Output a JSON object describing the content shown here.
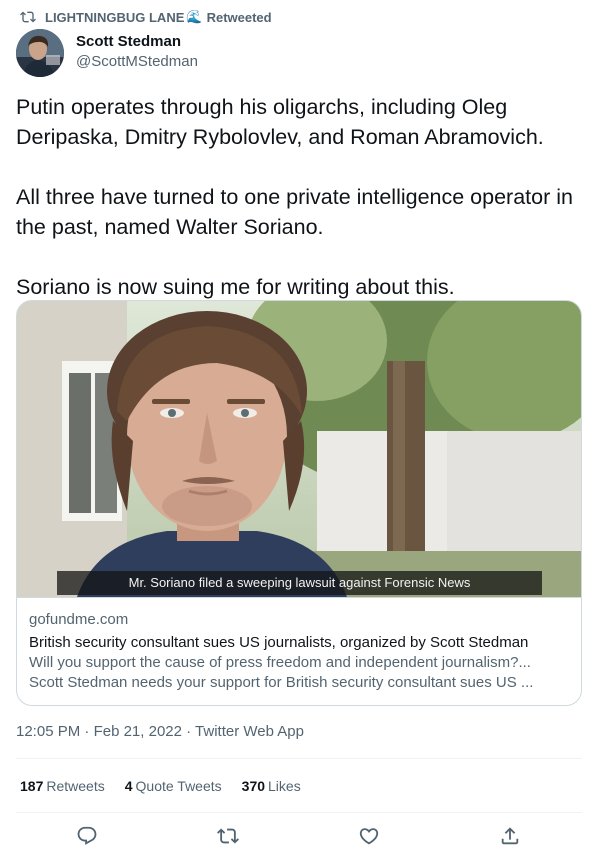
{
  "retweet": {
    "label": "LIGHTNINGBUG LANE",
    "wave": "🌊",
    "suffix": "Retweeted",
    "icon": "retweet-icon"
  },
  "author": {
    "display_name": "Scott Stedman",
    "handle": "@ScottMStedman"
  },
  "tweet": {
    "paragraphs": [
      "Putin operates through his oligarchs, including Oleg Deripaska, Dmitry Rybolovlev, and Roman Abramovich.",
      "All three have turned to one private intelligence operator in the past, named Walter Soriano.",
      "Soriano is now suing me for writing about this."
    ]
  },
  "card": {
    "caption": "Mr. Soriano filed a sweeping lawsuit against Forensic News",
    "domain": "gofundme.com",
    "title": "British security consultant sues US journalists, organized by Scott Stedman",
    "desc_line1": "Will you support the cause of press freedom and independent journalism?...",
    "desc_line2": "Scott Stedman needs your support for British security consultant sues US ..."
  },
  "meta": {
    "time": "12:05 PM",
    "sep": " · ",
    "date": "Feb 21, 2022",
    "source": "Twitter Web App"
  },
  "stats": {
    "retweets_count": "187",
    "retweets_label": "Retweets",
    "quotes_count": "4",
    "quotes_label": "Quote Tweets",
    "likes_count": "370",
    "likes_label": "Likes"
  },
  "actions": [
    "reply-icon",
    "retweet-icon",
    "like-icon",
    "share-icon"
  ],
  "colors": {
    "text": "#0f1419",
    "secondary": "#536471",
    "border": "#cfd9de",
    "divider": "#eff3f4",
    "accent": "#1d9bf0"
  }
}
